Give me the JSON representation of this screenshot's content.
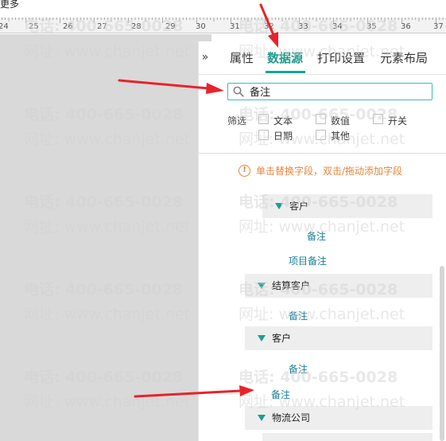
{
  "topbar": {
    "more_label": "更多"
  },
  "ruler": {
    "numbers": [
      "24",
      "25",
      "26",
      "27",
      "28",
      "29",
      "30",
      "31",
      "32",
      "33",
      "34",
      "35",
      "36",
      "37"
    ]
  },
  "panel": {
    "collapse_icon": "double-chevron-right-icon",
    "tabs": [
      {
        "label": "属性",
        "active": false
      },
      {
        "label": "数据源",
        "active": true
      },
      {
        "label": "打印设置",
        "active": false
      },
      {
        "label": "元素布局",
        "active": false
      }
    ],
    "search": {
      "value": "备注",
      "placeholder": ""
    },
    "filter": {
      "label": "筛选",
      "options": [
        {
          "label": "文本",
          "checked": false
        },
        {
          "label": "数值",
          "checked": false
        },
        {
          "label": "开关",
          "checked": false
        },
        {
          "label": "日期",
          "checked": false
        },
        {
          "label": "其他",
          "checked": false
        }
      ]
    },
    "hint": "单击替换字段，双击/拖动添加字段",
    "tree": [
      {
        "type": "group",
        "label": "客户"
      },
      {
        "type": "field",
        "label": "备注"
      },
      {
        "type": "field",
        "label": "项目备注"
      },
      {
        "type": "group",
        "label": "结算客户"
      },
      {
        "type": "field",
        "label": "备注"
      },
      {
        "type": "group",
        "label": "客户"
      },
      {
        "type": "field",
        "label": "备注"
      },
      {
        "type": "field",
        "label": "备注"
      },
      {
        "type": "group",
        "label": "物流公司"
      }
    ]
  },
  "watermark": {
    "phone": "电话: 400-665-0028",
    "site": "网址: www.chanjet.net"
  },
  "colors": {
    "accent": "#17a693",
    "hint": "#e8833a",
    "field_link": "#1a7f9a",
    "canvas": "#d9d9d9",
    "arrow": "#e8232a"
  }
}
